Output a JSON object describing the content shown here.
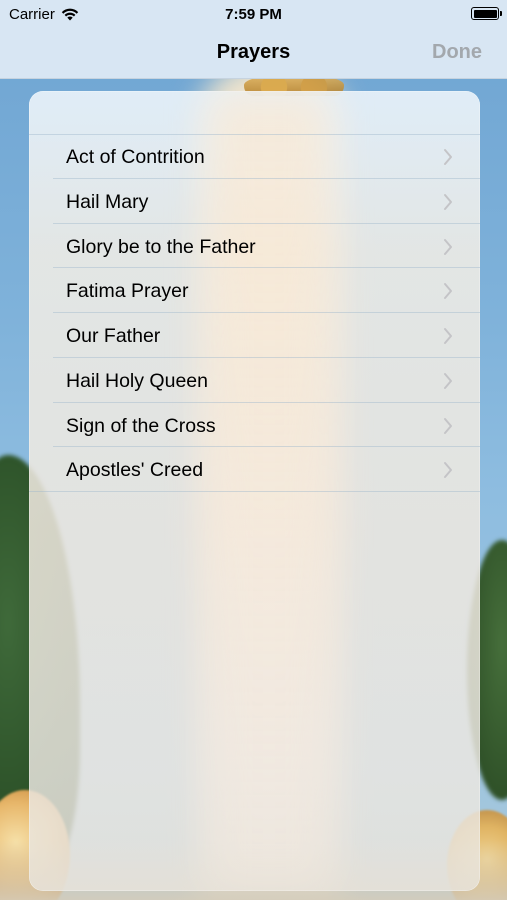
{
  "status_bar": {
    "carrier": "Carrier",
    "time": "7:59 PM",
    "icons": [
      "wifi-icon",
      "battery-icon"
    ]
  },
  "nav": {
    "title": "Prayers",
    "done_label": "Done"
  },
  "prayers": {
    "items": [
      {
        "label": "Act of Contrition"
      },
      {
        "label": "Hail Mary"
      },
      {
        "label": "Glory be to the Father"
      },
      {
        "label": "Fatima Prayer"
      },
      {
        "label": "Our Father"
      },
      {
        "label": "Hail Holy Queen"
      },
      {
        "label": "Sign of the Cross"
      },
      {
        "label": "Apostles' Creed"
      }
    ],
    "disclosure_icon": "chevron-right-icon"
  },
  "colors": {
    "nav_background": "#d8e6f3",
    "done_disabled": "#a3a8ad",
    "chevron": "#c4c4c7"
  }
}
